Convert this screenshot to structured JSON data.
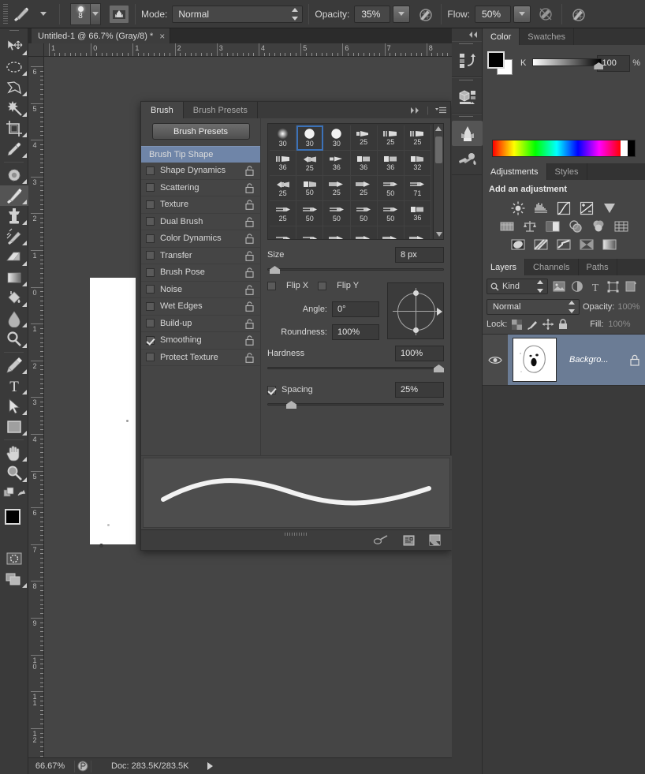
{
  "options_bar": {
    "brush_preview_icon": "brush-tool-icon",
    "brush_size_value": "8",
    "brush_panel_toggle_icon": "brush-panel-icon",
    "mode_label": "Mode:",
    "mode_value": "Normal",
    "opacity_label": "Opacity:",
    "opacity_value": "35%",
    "opacity_pressure_icon": "pressure-opacity-icon",
    "flow_label": "Flow:",
    "flow_value": "50%",
    "airbrush_icon": "airbrush-icon",
    "pressure_size_icon": "pressure-size-icon"
  },
  "document": {
    "tab_title": "Untitled-1 @ 66.7% (Gray/8) *",
    "close_label": "×"
  },
  "rulers": {
    "horizontal_labels": [
      "1",
      "0",
      "1",
      "2",
      "3",
      "4",
      "5",
      "6",
      "7",
      "8"
    ],
    "vertical_labels": [
      "6",
      "5",
      "4",
      "3",
      "2",
      "1",
      "0",
      "1",
      "2",
      "3",
      "4",
      "5",
      "6",
      "7",
      "8",
      "9",
      "10",
      "11",
      "12"
    ]
  },
  "status_bar": {
    "zoom": "66.67%",
    "doc_icon": "document-info-icon",
    "doc_info": "Doc: 283.5K/283.5K",
    "expand_icon": "play-arrow-icon"
  },
  "toolbox": {
    "tools": [
      {
        "name": "move-tool",
        "selected": false
      },
      {
        "name": "elliptical-marquee-tool",
        "selected": false
      },
      {
        "name": "lasso-tool",
        "selected": false
      },
      {
        "name": "magic-wand-tool",
        "selected": false
      },
      {
        "name": "crop-tool",
        "selected": false
      },
      {
        "name": "eyedropper-tool",
        "selected": false
      },
      {
        "name": "spot-healing-brush-tool",
        "selected": false
      },
      {
        "name": "brush-tool",
        "selected": true
      },
      {
        "name": "clone-stamp-tool",
        "selected": false
      },
      {
        "name": "history-brush-tool",
        "selected": false
      },
      {
        "name": "eraser-tool",
        "selected": false
      },
      {
        "name": "gradient-tool",
        "selected": false
      },
      {
        "name": "blur-tool",
        "selected": false
      },
      {
        "name": "dodge-tool",
        "selected": false
      },
      {
        "name": "pen-tool",
        "selected": false
      },
      {
        "name": "horizontal-type-tool",
        "selected": false
      },
      {
        "name": "path-selection-tool",
        "selected": false
      },
      {
        "name": "rectangle-tool",
        "selected": false
      },
      {
        "name": "hand-tool",
        "selected": false
      },
      {
        "name": "zoom-tool",
        "selected": false
      }
    ],
    "foreground_color": "#000000",
    "background_color": "#ffffff",
    "quick_mask_icon": "quick-mask-icon",
    "screen_mode_icon": "screen-mode-icon"
  },
  "brush_panel": {
    "tabs": [
      {
        "label": "Brush",
        "active": true
      },
      {
        "label": "Brush Presets",
        "active": false
      }
    ],
    "collapse_icon": "double-chevron-right-icon",
    "menu_icon": "panel-menu-icon",
    "presets_button": "Brush Presets",
    "tip_shape_label": "Brush Tip Shape",
    "options": [
      {
        "label": "Shape Dynamics",
        "checked": false
      },
      {
        "label": "Scattering",
        "checked": false
      },
      {
        "label": "Texture",
        "checked": false
      },
      {
        "label": "Dual Brush",
        "checked": false
      },
      {
        "label": "Color Dynamics",
        "checked": false
      },
      {
        "label": "Transfer",
        "checked": false
      },
      {
        "label": "Brush Pose",
        "checked": false
      },
      {
        "label": "Noise",
        "checked": false
      },
      {
        "label": "Wet Edges",
        "checked": false
      },
      {
        "label": "Build-up",
        "checked": false
      },
      {
        "label": "Smoothing",
        "checked": true
      },
      {
        "label": "Protect Texture",
        "checked": false
      }
    ],
    "tips": [
      {
        "size": "30",
        "shape": "soft-round",
        "selected": false
      },
      {
        "size": "30",
        "shape": "hard-round",
        "selected": true
      },
      {
        "size": "30",
        "shape": "hard-round",
        "selected": false
      },
      {
        "size": "25",
        "shape": "flat-angle",
        "selected": false
      },
      {
        "size": "25",
        "shape": "flat-bristle",
        "selected": false
      },
      {
        "size": "25",
        "shape": "flat-bristle",
        "selected": false
      },
      {
        "size": "36",
        "shape": "flat-bristle",
        "selected": false
      },
      {
        "size": "25",
        "shape": "fan-bristle",
        "selected": false
      },
      {
        "size": "36",
        "shape": "round-point",
        "selected": false
      },
      {
        "size": "36",
        "shape": "flat-blunt",
        "selected": false
      },
      {
        "size": "36",
        "shape": "flat-blunt",
        "selected": false
      },
      {
        "size": "32",
        "shape": "angle-blunt",
        "selected": false
      },
      {
        "size": "25",
        "shape": "fan-bristle",
        "selected": false
      },
      {
        "size": "50",
        "shape": "angle-blunt",
        "selected": false
      },
      {
        "size": "25",
        "shape": "round-blunt",
        "selected": false
      },
      {
        "size": "25",
        "shape": "round-blunt",
        "selected": false
      },
      {
        "size": "50",
        "shape": "thin-point",
        "selected": false
      },
      {
        "size": "71",
        "shape": "thin-point",
        "selected": false
      },
      {
        "size": "25",
        "shape": "thin-point",
        "selected": false
      },
      {
        "size": "50",
        "shape": "thin-point",
        "selected": false
      },
      {
        "size": "50",
        "shape": "thin-point",
        "selected": false
      },
      {
        "size": "50",
        "shape": "thin-point",
        "selected": false
      },
      {
        "size": "50",
        "shape": "thin-point",
        "selected": false
      },
      {
        "size": "36",
        "shape": "flat-blunt",
        "selected": false
      }
    ],
    "tips_last_row": [
      "thin-point",
      "thin-point",
      "round-blunt",
      "round-blunt",
      "round-blunt",
      "round-blunt"
    ],
    "size_label": "Size",
    "size_value": "8 px",
    "flip_x_label": "Flip X",
    "flip_x_checked": false,
    "flip_y_label": "Flip Y",
    "flip_y_checked": false,
    "angle_label": "Angle:",
    "angle_value": "0°",
    "roundness_label": "Roundness:",
    "roundness_value": "100%",
    "hardness_label": "Hardness",
    "hardness_value": "100%",
    "spacing_label": "Spacing",
    "spacing_checked": true,
    "spacing_value": "25%",
    "footer_icons": [
      "toggle-brush-panel-icon",
      "new-preset-icon",
      "delete-brush-icon"
    ]
  },
  "icon_dock": {
    "collapse_icon": "double-chevron-left-icon",
    "items": [
      {
        "name": "history-icon"
      },
      {
        "name": "3d-icon"
      },
      {
        "name": "brush-panel-icon",
        "selected": true
      },
      {
        "name": "tool-presets-icon"
      }
    ]
  },
  "color_panel": {
    "tabs": [
      {
        "label": "Color",
        "active": true
      },
      {
        "label": "Swatches",
        "active": false
      }
    ],
    "channel_label": "K",
    "channel_value": "100",
    "percent_symbol": "%",
    "foreground_color": "#000000",
    "background_color": "#ffffff"
  },
  "adjustments_panel": {
    "tabs": [
      {
        "label": "Adjustments",
        "active": true
      },
      {
        "label": "Styles",
        "active": false
      }
    ],
    "title": "Add an adjustment",
    "row1": [
      "brightness-contrast-icon",
      "levels-icon",
      "curves-icon",
      "exposure-icon",
      "vibrance-icon"
    ],
    "row2": [
      "hue-saturation-icon",
      "color-balance-icon",
      "black-white-icon",
      "photo-filter-icon",
      "channel-mixer-icon",
      "color-lookup-icon"
    ],
    "row3": [
      "invert-icon",
      "posterize-icon",
      "threshold-icon",
      "selective-color-icon",
      "gradient-map-icon"
    ]
  },
  "layers_panel": {
    "tabs": [
      {
        "label": "Layers",
        "active": true
      },
      {
        "label": "Channels",
        "active": false
      },
      {
        "label": "Paths",
        "active": false
      }
    ],
    "filter_label": "Kind",
    "filter_icons": [
      "filter-image-icon",
      "filter-adjustment-icon",
      "filter-type-icon",
      "filter-shape-icon",
      "filter-smart-icon"
    ],
    "blend_mode": "Normal",
    "opacity_label": "Opacity:",
    "opacity_value": "100%",
    "lock_label": "Lock:",
    "lock_icons": [
      "lock-transparency-icon",
      "lock-image-icon",
      "lock-position-icon",
      "lock-all-icon"
    ],
    "fill_label": "Fill:",
    "fill_value": "100%",
    "layers": [
      {
        "name": "Backgro...",
        "visible": true,
        "locked": true,
        "thumbnail": "face-sketch-thumbnail"
      }
    ]
  }
}
